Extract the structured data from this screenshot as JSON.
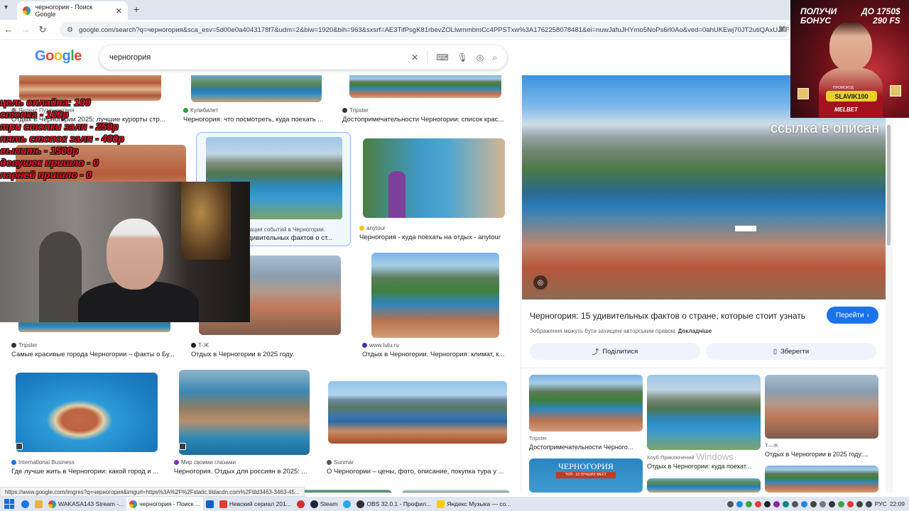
{
  "browser": {
    "tab_title": "черногория - Поиск Google",
    "url": "google.com/search?q=черногория&sca_esv=5d00e0a4043178f7&udm=2&biw=1920&bih=963&sxsrf=AE3TifPsgK81rbevZOLlwmmbmCc4PPSTxw%3A1762258078481&ei=nuwJafuJHYmo5NoPs6rl0Ao&ved=0ahUKEwj70JT2utiQAxUJFFkF..."
  },
  "google": {
    "logo_letters": [
      "G",
      "o",
      "o",
      "g",
      "l",
      "e"
    ],
    "query": "черногория"
  },
  "results": [
    {
      "source": "Яндекс Путешествия",
      "title": "Отдых в Черногории 2025: лучшие курорты стр..."
    },
    {
      "source": "Кулибилет",
      "title": "Черногория: что посмотреть, куда поехать ..."
    },
    {
      "source": "Tripster",
      "title": "Достопримечательности Черногории: список крас..."
    },
    {
      "source": "...изация событий в Черногории.",
      "title": "...удивительных фактов о ст..."
    },
    {
      "source": "anytour",
      "title": "Черногория - куда поехать на отдых - anytour"
    },
    {
      "source": "Tripster",
      "title": "Самые красивые города Черногории – факты о Бу..."
    },
    {
      "source": "Т-Ж",
      "title": "Отдых в Черногории в 2025 году."
    },
    {
      "source": "www.tutu.ru",
      "title": "Отдых в Черногории. Черногория: климат, к..."
    },
    {
      "source": "International Business",
      "title": "Где лучше жить в Черногории: какой город и ..."
    },
    {
      "source": "Мир своими глазами",
      "title": "Черногория. Отдых для россиян в 2025: ..."
    },
    {
      "source": "Sunmar",
      "title": "О Черногории – цены, фото, описание, покупка тура у ..."
    }
  ],
  "panel": {
    "title": "Черногория: 15 удивительных фактов о стране, которые стоит узнать",
    "goto_label": "Перейти",
    "copyright": "Зображення можуть бути захищені авторським правом.",
    "copyright_link": "Докладніше",
    "share_label": "Поділитися",
    "save_label": "Зберегти",
    "related": [
      {
        "source": "Tripster",
        "title": "Достопримечательности Черного..."
      },
      {
        "source": "Клуб Приключений",
        "title": "Отдых в Черногории: куда поехат..."
      },
      {
        "source": "Т—Ж",
        "title": "Отдых в Черногории в 2025 году:..."
      }
    ],
    "related_banner": "ЧЕРНОГОРИЯ",
    "related_banner_sub": "ТОП - 10 ЛУЧШИХ МЕСТ"
  },
  "overlay_caption": "ссылка в описан",
  "stream_lines": [
    "цель онлайна: 100",
    "стопка - 100р",
    "три стопки залп - 250р",
    "пять стопок  залп - 400р",
    "выпить - 1500р",
    "девушек пришло - 0",
    "парней пришло - 0"
  ],
  "ad": {
    "line1": "ПОЛУЧИ",
    "line2": "БОНУС",
    "amount1": "ДО 1750$",
    "amount2": "290 FS",
    "promo_small": "ПРОМОКОД",
    "promo_code": "SLAVIK100",
    "brand": "MELBET"
  },
  "status_url": "https://www.google.com/imgres?q=черногория&imgurl=https%3A%2F%2Fstatic.tildacdn.com%2Ftild3463-3463-45...",
  "watermark": "Windows",
  "taskbar": {
    "items": [
      "WAKASA143 Stream -...",
      "черногория - Поиск ...",
      "Невский сериал 201...",
      "Steam",
      "OBS 32.0.1 - Профил...",
      "Яндекс Музыка — со..."
    ],
    "lang": "РУС",
    "time": "22:09"
  }
}
